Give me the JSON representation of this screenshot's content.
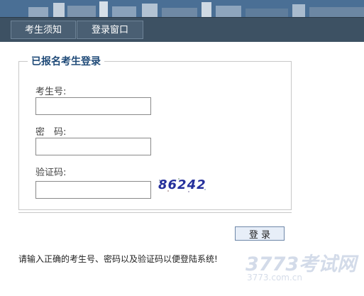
{
  "nav": {
    "tabs": [
      {
        "label": "考生须知"
      },
      {
        "label": "登录窗口"
      }
    ]
  },
  "login_form": {
    "legend": "已报名考生登录",
    "fields": {
      "candidate_no": {
        "label": "考生号:",
        "value": ""
      },
      "password": {
        "label": "密　码:",
        "value": ""
      },
      "captcha": {
        "label": "验证码:",
        "value": ""
      }
    },
    "captcha_image_text": "86242",
    "submit_label": "登 录"
  },
  "notice_text": "请输入正确的考生号、密码以及验证码以便登陆系统!",
  "watermark": {
    "main": "3773考试网",
    "sub": "3773.com.cn"
  },
  "colors": {
    "nav_bg": "#3d5163",
    "legend_text": "#1f4a78",
    "captcha_text": "#25309c"
  }
}
